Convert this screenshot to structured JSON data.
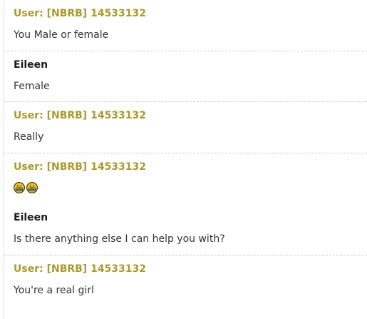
{
  "messages": [
    {
      "sender": "User: [NBRB] 14533132",
      "role": "user",
      "text": "You Male or female"
    },
    {
      "sender": "Eileen",
      "role": "bot",
      "text": "Female"
    },
    {
      "sender": "User: [NBRB] 14533132",
      "role": "user",
      "text": "Really"
    },
    {
      "sender": "User: [NBRB] 14533132",
      "role": "user",
      "emojis": [
        "grinning-face-emoji",
        "grinning-face-emoji"
      ]
    },
    {
      "sender": "Eileen",
      "role": "bot",
      "text": "Is there anything else I can help you with?"
    },
    {
      "sender": "User: [NBRB] 14533132",
      "role": "user",
      "text": "You're a real girl"
    }
  ],
  "colors": {
    "user_name": "#a99a2e",
    "bot_name": "#1a1a1a",
    "message_text": "#333333",
    "divider": "#cfcfcf",
    "emoji_face": "#f5c518"
  }
}
